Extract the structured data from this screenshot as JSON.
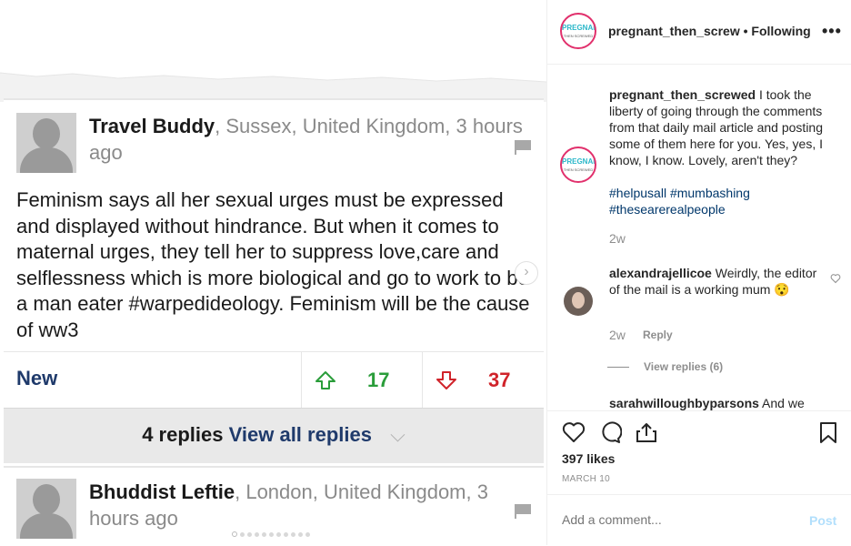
{
  "post_image": {
    "comment1": {
      "author": "Travel Buddy",
      "meta_line1": ", Sussex, United Kingdom, 3 hours",
      "meta_line2": "ago",
      "body": "Feminism says all her sexual urges must be expressed and displayed without hindrance. But when it comes to maternal urges, they tell her to suppress love,care and selflessness which is more biological and go to work to be a man eater #warpedideology. Feminism will be the cause of ww3"
    },
    "sort_label": "New",
    "upvotes": "17",
    "downvotes": "37",
    "replies_count": "4 replies",
    "view_all_label": "View all replies",
    "comment2": {
      "author": "Bhuddist Leftie",
      "meta_line1": ", London, United Kingdom, 3",
      "meta_line2": "hours ago"
    },
    "colors": {
      "upvote": "#2a9d3a",
      "downvote": "#d0232a",
      "link": "#1f3a6b"
    }
  },
  "panel": {
    "logo": {
      "line1": "PREGNANT",
      "line2": "THEN SCREWED"
    },
    "header": {
      "username": "pregnant_then_screw",
      "separator": " • ",
      "follow_status": "Following",
      "more": "•••"
    },
    "caption": {
      "username": "pregnant_then_screwed",
      "text": " I took the liberty of going through the comments from that daily mail article and posting some of them here for you. Yes, yes, I know, I know. Lovely, aren't they?",
      "hashtags": "#helpusall #mumbashing #thesearerealpeople",
      "time": "2w"
    },
    "comments": [
      {
        "username": "alexandrajellicoe",
        "text": " Weirdly, the editor of the mail is a working mum 😯",
        "time": "2w",
        "reply_label": "Reply",
        "view_replies": "View replies (6)"
      },
      {
        "username": "sarahwilloughbyparsons",
        "text": " And we"
      }
    ],
    "likes": "397 likes",
    "date": "MARCH 10",
    "add_comment_placeholder": "Add a comment...",
    "post_label": "Post"
  }
}
